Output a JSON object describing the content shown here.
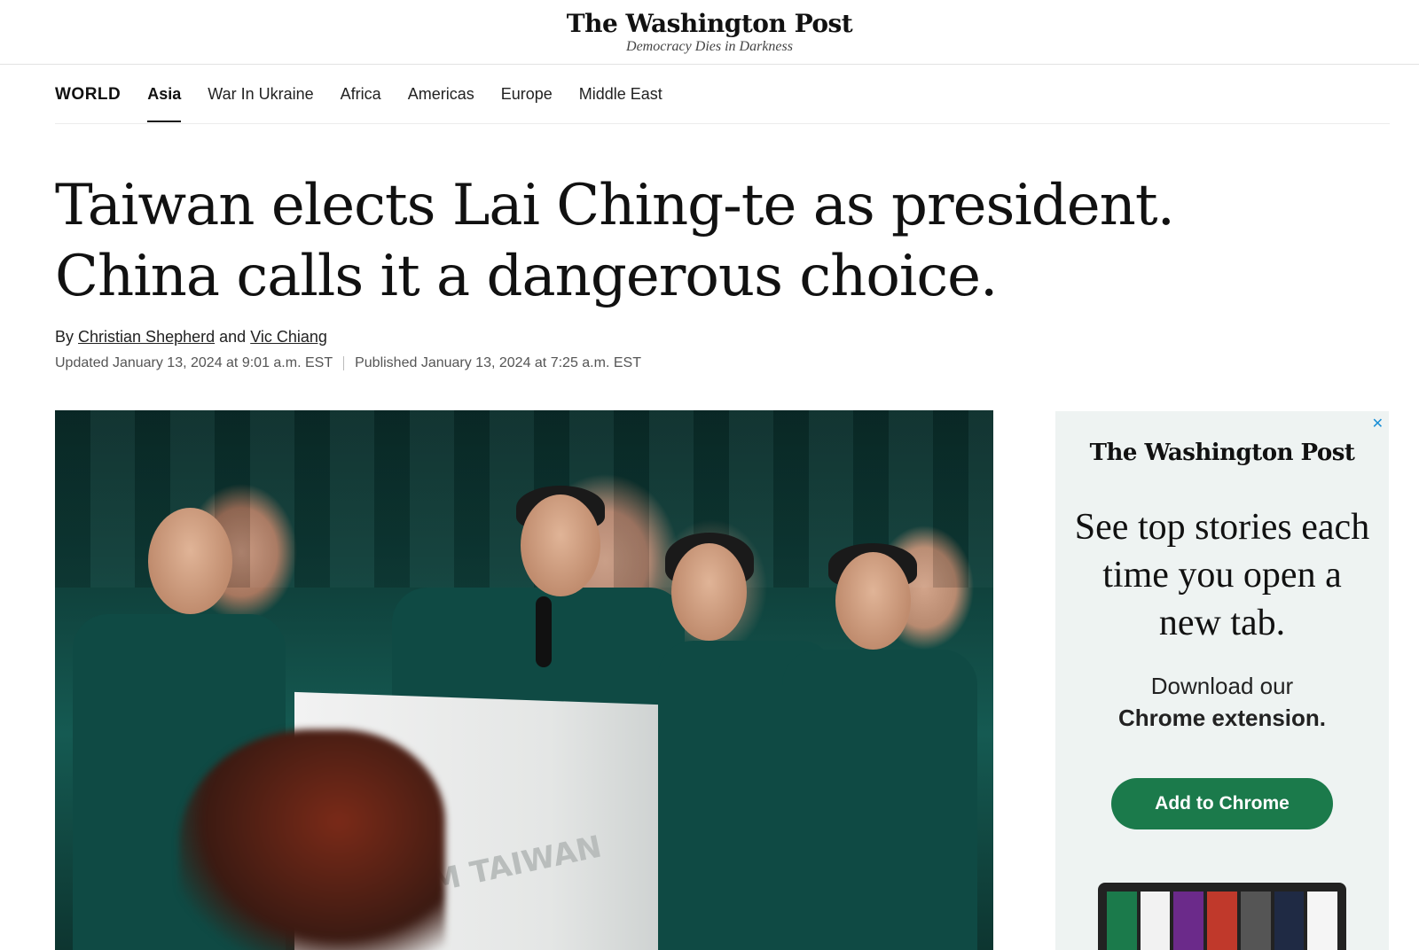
{
  "masthead": {
    "logo": "The Washington Post",
    "tagline": "Democracy Dies in Darkness"
  },
  "section_nav": {
    "section": "WORLD",
    "items": [
      {
        "label": "Asia",
        "active": true
      },
      {
        "label": "War In Ukraine",
        "active": false
      },
      {
        "label": "Africa",
        "active": false
      },
      {
        "label": "Americas",
        "active": false
      },
      {
        "label": "Europe",
        "active": false
      },
      {
        "label": "Middle East",
        "active": false
      }
    ]
  },
  "article": {
    "headline_line1": "Taiwan elects Lai Ching-te as president.",
    "headline_line2": "China calls it a dangerous choice.",
    "byline_prefix": "By",
    "author1": "Christian Shepherd",
    "byline_and": "and",
    "author2": "Vic Chiang",
    "updated": "Updated January 13, 2024 at 9:01 a.m. EST",
    "published": "Published January 13, 2024 at 7:25 a.m. EST",
    "photo_podium_text": "TEAM TAIWAN"
  },
  "ad": {
    "close_icon": "close-icon",
    "close_glyph": "✕",
    "logo": "The Washington Post",
    "headline": "See top stories each time you open a new tab.",
    "sub_line1": "Download our",
    "sub_line2": "Chrome extension.",
    "button_label": "Add to Chrome",
    "button_color": "#1b7a4b",
    "tile_colors": [
      "#1b7a4b",
      "#f2f2f2",
      "#6b2a8a",
      "#c0392b",
      "#555555",
      "#1f2a44",
      "#f5f5f5"
    ]
  }
}
